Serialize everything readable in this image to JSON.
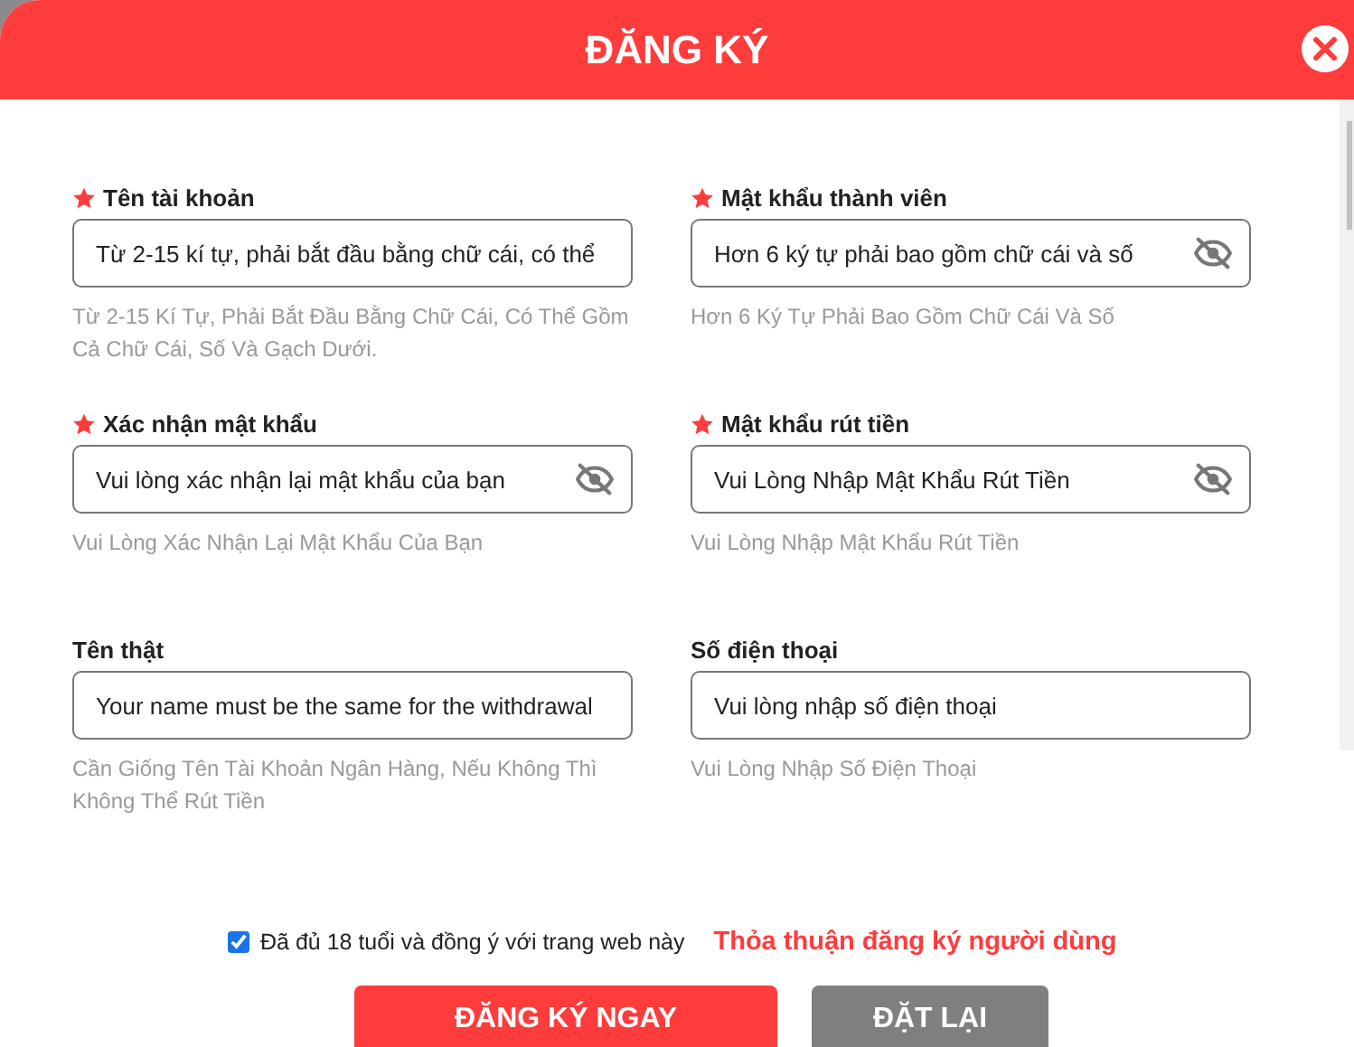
{
  "window": {
    "title": "ĐĂNG KÝ"
  },
  "fields": [
    {
      "label": "Tên tài khoản",
      "required": true,
      "kind": "text",
      "placeholder": "Từ 2-15 kí tự, phải bắt đầu bằng chữ cái, có thể",
      "hint": "Từ 2-15 Kí Tự, Phải Bắt Đầu Bằng Chữ Cái, Có Thể Gồm Cả Chữ Cái, Số Và Gạch Dưới."
    },
    {
      "label": "Mật khẩu thành viên",
      "required": true,
      "kind": "password",
      "placeholder": "Hơn 6 ký tự phải bao gồm chữ cái và số",
      "hint": "Hơn 6 Ký Tự Phải Bao Gồm Chữ Cái Và Số"
    },
    {
      "label": "Xác nhận mật khẩu",
      "required": true,
      "kind": "password",
      "placeholder": "Vui lòng xác nhận lại mật khẩu của bạn",
      "hint": "Vui Lòng Xác Nhận Lại Mật Khẩu Của Bạn"
    },
    {
      "label": "Mật khẩu rút tiền",
      "required": true,
      "kind": "password",
      "placeholder": "Vui Lòng Nhập Mật Khẩu Rút Tiền",
      "hint": "Vui Lòng Nhập Mật Khẩu Rút Tiền"
    },
    {
      "label": "Tên thật",
      "required": false,
      "kind": "text",
      "placeholder": "Your name must be the same for the withdrawal",
      "hint": "Cần Giống Tên Tài Khoản Ngân Hàng, Nếu Không Thì Không Thể Rút Tiền"
    },
    {
      "label": "Số điện thoại",
      "required": false,
      "kind": "text",
      "placeholder": "Vui lòng nhập số điện thoại",
      "hint": "Vui Lòng Nhập Số Điện Thoại"
    }
  ],
  "agreement": {
    "checked": true,
    "label": "Đã đủ 18 tuổi và đồng ý với trang web này",
    "link": "Thỏa thuận đăng ký người dùng"
  },
  "buttons": [
    {
      "label": "ĐĂNG KÝ NGAY",
      "kind": "primary"
    },
    {
      "label": "ĐẶT LẠI",
      "kind": "secondary"
    }
  ]
}
